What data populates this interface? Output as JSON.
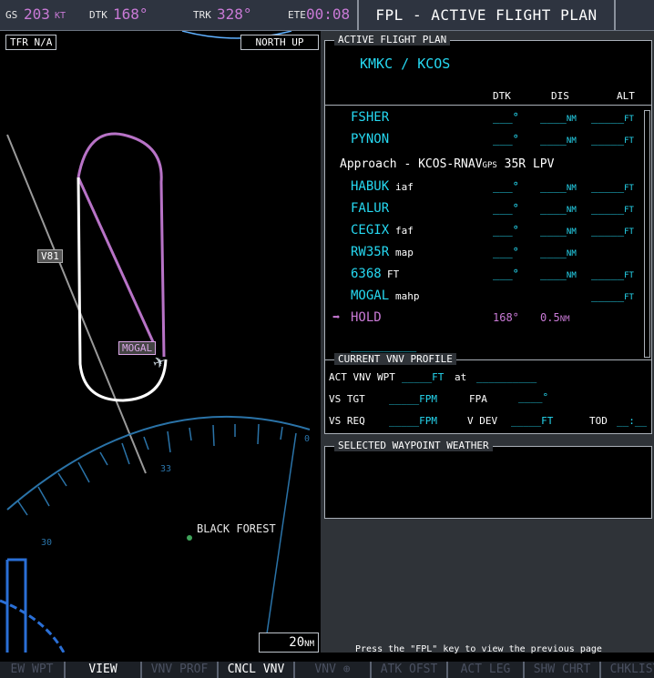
{
  "top_bar": {
    "gs_label": "GS",
    "gs_value": "203",
    "gs_unit": "KT",
    "dtk_label": "DTK",
    "dtk_value": "168°",
    "trk_label": "TRK",
    "trk_value": "328°",
    "ete_label": "ETE",
    "ete_value": "00:08",
    "page_title": "FPL - ACTIVE FLIGHT PLAN"
  },
  "map": {
    "tfr_label": "TFR N/A",
    "orientation": "NORTH UP",
    "airway": "V81",
    "waypoint_label": "MOGAL",
    "compass_33": "33",
    "compass_30": "30",
    "compass_0": "0",
    "town": "BLACK FOREST",
    "range_value": "20",
    "range_unit": "NM"
  },
  "fpl": {
    "title": "ACTIVE FLIGHT PLAN",
    "route": "KMKC / KCOS",
    "col_dtk": "DTK",
    "col_dis": "DIS",
    "col_alt": "ALT",
    "rows": [
      {
        "name": "FSHER",
        "suffix": "",
        "dtk": "___°",
        "dis": "____",
        "dis_unit": "NM",
        "alt": "_____",
        "alt_unit": "FT"
      },
      {
        "name": "PYNON",
        "suffix": "",
        "dtk": "___°",
        "dis": "____",
        "dis_unit": "NM",
        "alt": "_____",
        "alt_unit": "FT"
      },
      {
        "name": "HABUK",
        "suffix": "iaf",
        "dtk": "___°",
        "dis": "____",
        "dis_unit": "NM",
        "alt": "_____",
        "alt_unit": "FT"
      },
      {
        "name": "FALUR",
        "suffix": "",
        "dtk": "___°",
        "dis": "____",
        "dis_unit": "NM",
        "alt": "_____",
        "alt_unit": "FT"
      },
      {
        "name": "CEGIX",
        "suffix": "faf",
        "dtk": "___°",
        "dis": "____",
        "dis_unit": "NM",
        "alt": "_____",
        "alt_unit": "FT"
      },
      {
        "name": "RW35R",
        "suffix": "map",
        "dtk": "___°",
        "dis": "____",
        "dis_unit": "NM",
        "alt": "",
        "alt_unit": ""
      },
      {
        "name": "6368",
        "suffix": "FT",
        "dtk": "___°",
        "dis": "____",
        "dis_unit": "NM",
        "alt": "_____",
        "alt_unit": "FT"
      },
      {
        "name": "MOGAL",
        "suffix": "mahp",
        "dtk": "",
        "dis": "",
        "dis_unit": "",
        "alt": "_____",
        "alt_unit": "FT"
      },
      {
        "name": "HOLD",
        "suffix": "",
        "dtk": "168°",
        "dis": "0.5",
        "dis_unit": "NM",
        "alt": "",
        "alt_unit": ""
      }
    ],
    "approach_prefix": "Approach - KCOS-RNAV",
    "approach_gps": "GPS",
    "approach_suffix": " 35R LPV",
    "empty_row": "__________"
  },
  "vnv": {
    "title": "CURRENT VNV PROFILE",
    "act_label": "ACT VNV WPT",
    "act_alt": "_____FT",
    "act_at": "at",
    "act_wpt": "__________",
    "vs_tgt_label": "VS TGT",
    "vs_tgt_value": "_____FPM",
    "fpa_label": "FPA",
    "fpa_value": "____°",
    "vs_req_label": "VS REQ",
    "vs_req_value": "_____FPM",
    "vdev_label": "V DEV",
    "vdev_value": "_____FT",
    "tod_label": "TOD",
    "tod_value": "__:__"
  },
  "weather": {
    "title": "SELECTED WAYPOINT WEATHER"
  },
  "footer_msg": "Press the \"FPL\" key to view the previous page",
  "softkeys": [
    {
      "label": "EW WPT",
      "enabled": false,
      "w": 70
    },
    {
      "label": "VIEW",
      "enabled": true,
      "w": 82
    },
    {
      "label": "VNV PROF",
      "enabled": false,
      "w": 82
    },
    {
      "label": "CNCL VNV",
      "enabled": true,
      "w": 82
    },
    {
      "label": "VNV ⊕",
      "enabled": false,
      "w": 82
    },
    {
      "label": "ATK OFST",
      "enabled": false,
      "w": 82
    },
    {
      "label": "ACT LEG",
      "enabled": false,
      "w": 82
    },
    {
      "label": "SHW CHRT",
      "enabled": false,
      "w": 82
    },
    {
      "label": "CHKLIST",
      "enabled": false,
      "w": 74
    }
  ],
  "colors": {
    "magenta": "#c97ad6",
    "cyan": "#26d9f2",
    "background": "#000000"
  }
}
